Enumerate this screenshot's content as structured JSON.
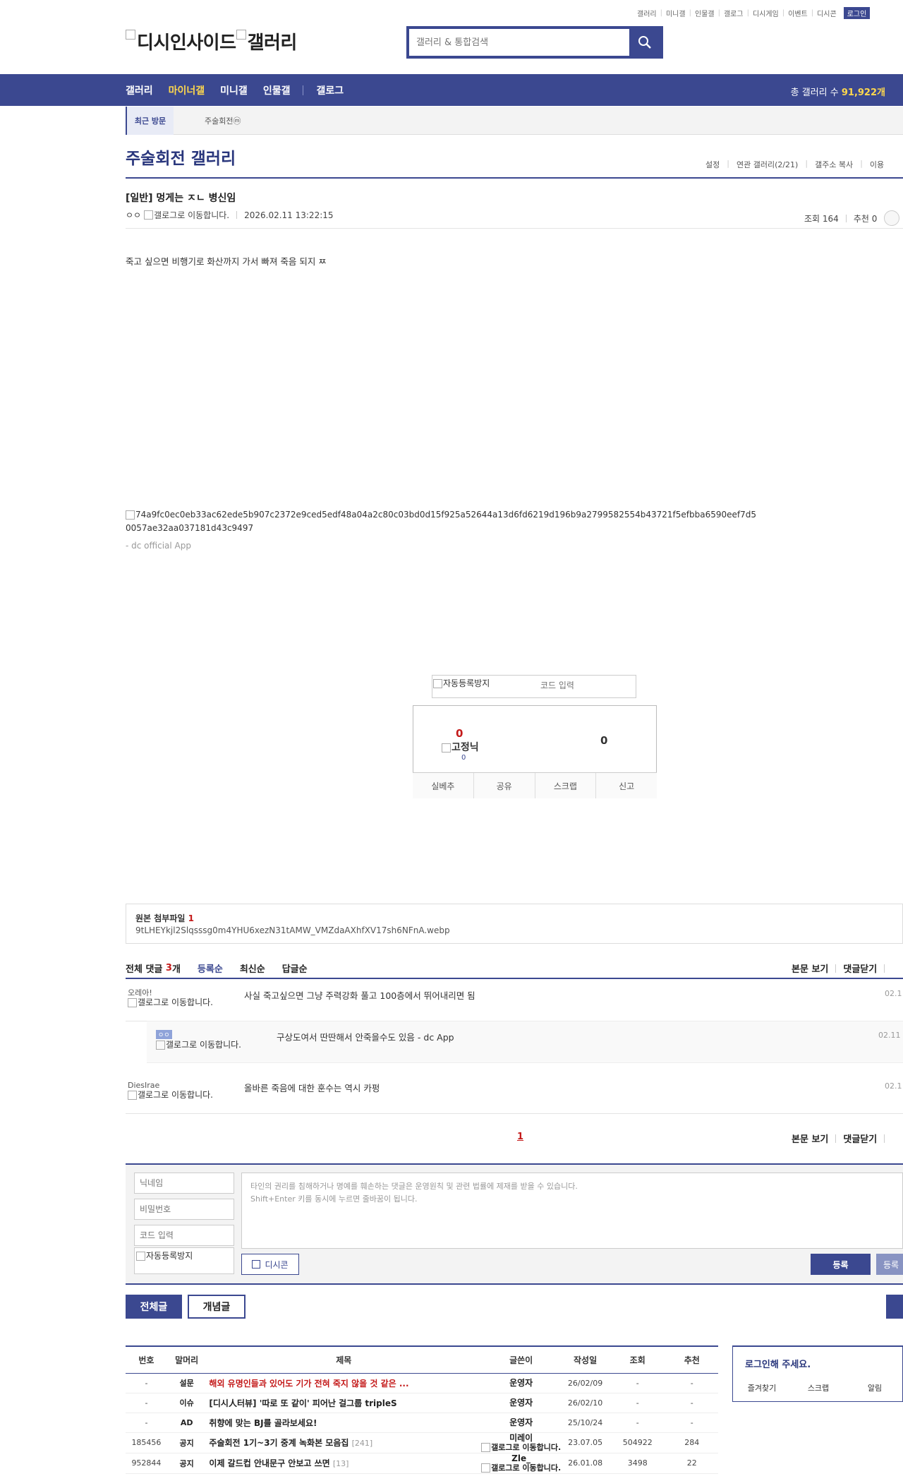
{
  "top_links": [
    "갤러리",
    "미니갤",
    "인물갤",
    "갤로그",
    "디시게임",
    "이벤트",
    "디시콘"
  ],
  "login_label": "로그인",
  "logo": {
    "text_a": "디시인사이드",
    "text_b": "갤러리"
  },
  "search": {
    "placeholder": "갤러리 & 통합검색"
  },
  "nav": {
    "items": [
      "갤러리",
      "마이너갤",
      "미니갤",
      "인물갤"
    ],
    "active": "마이너갤",
    "gallog": "갤로그",
    "count_label": "총 갤러리 수",
    "count_value": "91,922개"
  },
  "recent": {
    "label": "최근 방문",
    "item": "주술회전ⓜ"
  },
  "gallery": {
    "title": "주술회전 갤러리",
    "tools": [
      "설정",
      "연관 갤러리(2/21)",
      "갤주소 복사",
      "이용"
    ]
  },
  "post": {
    "title": "[일반] 멍게는 ㅈㄴ 병신임",
    "author": "ㅇㅇ",
    "gallog_alt": "갤로그로 이동합니다.",
    "date": "2026.02.11 13:22:15",
    "views": "조회 164",
    "recommends": "추천 0",
    "body": "죽고 싶으면 비행기로 화산까지 가서 빠져 죽음 되지 ㅉ",
    "image_alt": "74a9fc0ec0eb33ac62ede5b907c2372e9ced5edf48a04a2c80c03bd0d15f925a52644a13d6fd6219d196b9a2799582554b43721f5efbba6590eef7d50057ae32aa037181d43c9497",
    "app_sign": "- dc official App"
  },
  "captcha": {
    "img_alt": "자동등록방지",
    "placeholder": "코드 입력"
  },
  "recommend": {
    "up": "0",
    "fixed_alt": "고정닉",
    "fixed_count": "0",
    "down": "0",
    "actions": [
      "실베추",
      "공유",
      "스크랩",
      "신고"
    ]
  },
  "attach": {
    "title": "원본 첨부파일",
    "count": "1",
    "file": "9tLHEYkjl2Slqsssg0m4YHU6xezN31tAMW_VMZdaAXhfXV17sh6NFnA.webp"
  },
  "comments": {
    "head": "전체 댓글",
    "count": "3",
    "unit": "개",
    "sorts": [
      "등록순",
      "최신순",
      "답글순"
    ],
    "right_links": [
      "본문 보기",
      "댓글닫기"
    ],
    "items": [
      {
        "nick": "오레아!",
        "ico": "갤로그로 이동합니다.",
        "text": "사실 죽고싶으면 그냥 주력강화 풀고 100층에서 뛰어내리면 됨",
        "date": "02.1"
      },
      {
        "nick": "ㅇㅇ",
        "ico": "갤로그로 이동합니다.",
        "text": "구상도여서 딴딴해서 안죽을수도 있음 - dc App",
        "date": "02.11"
      },
      {
        "nick": "DiesIrae",
        "ico": "갤로그로 이동합니다.",
        "text": "올바른 죽음에 대한 훈수는 역시 카펑",
        "date": "02.1"
      }
    ],
    "page": "1"
  },
  "form": {
    "nick_ph": "닉네임",
    "pw_ph": "비밀번호",
    "code_ph": "코드 입력",
    "captcha_alt": "자동등록방지",
    "textarea_line1": "타인의 권리를 침해하거나 명예를 훼손하는 댓글은 운영원칙 및 관련 법률에 제재를 받을 수 있습니다.",
    "textarea_line2": "Shift+Enter 키를 동시에 누르면 줄바꿈이 됩니다.",
    "dccon": "디시콘",
    "submit": "등록",
    "submit2": "등록"
  },
  "list_buttons": {
    "all": "전체글",
    "concept": "개념글"
  },
  "list": {
    "headers": [
      "번호",
      "말머리",
      "제목",
      "글쓴이",
      "작성일",
      "조회",
      "추천"
    ],
    "rows": [
      {
        "num": "-",
        "subj": "설문",
        "title": "해외 유명인들과 있어도 기가 전혀 죽지 않을 것 같은 ...",
        "reply": "",
        "writer": "운영자",
        "writer_ico": "",
        "date": "26/02/09",
        "views": "-",
        "rec": "-",
        "hot": true
      },
      {
        "num": "-",
        "subj": "이슈",
        "title": "[디시人터뷰] '따로 또 같이' 피어난 걸그룹 tripleS",
        "reply": "",
        "writer": "운영자",
        "writer_ico": "",
        "date": "26/02/10",
        "views": "-",
        "rec": "-",
        "hot": false
      },
      {
        "num": "-",
        "subj": "AD",
        "title": "취향에 맞는 BJ를 골라보세요!",
        "reply": "",
        "writer": "운영자",
        "writer_ico": "",
        "date": "25/10/24",
        "views": "-",
        "rec": "-",
        "hot": false
      },
      {
        "num": "185456",
        "subj": "공지",
        "title": "주술회전 1기~3기 중계 녹화본 모음집",
        "reply": "[241]",
        "writer": "미레이",
        "writer_ico": "갤로그로 이동합니다.",
        "date": "23.07.05",
        "views": "504922",
        "rec": "284",
        "hot": false
      },
      {
        "num": "952844",
        "subj": "공지",
        "title": "이제 갈드컵 안내문구 안보고 쓰면",
        "reply": "[13]",
        "writer": "Zle_",
        "writer_ico": "갤로그로 이동합니다.",
        "date": "26.01.08",
        "views": "3498",
        "rec": "22",
        "hot": false
      }
    ]
  },
  "login_box": {
    "title": "로그인해 주세요.",
    "links": [
      "즐겨찾기",
      "스크랩",
      "알림"
    ]
  }
}
